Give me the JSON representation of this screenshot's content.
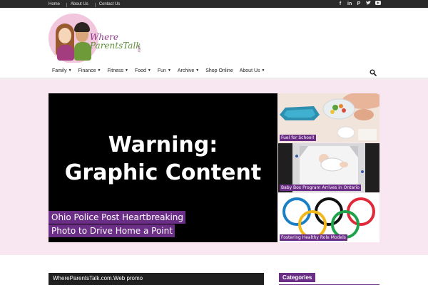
{
  "topbar": {
    "links": [
      "Home",
      "About Us",
      "Contact Us"
    ],
    "social": [
      "facebook-icon",
      "linkedin-icon",
      "pinterest-icon",
      "twitter-icon",
      "youtube-icon"
    ]
  },
  "logo": {
    "line1": "Where",
    "line2": "ParentsTalk",
    "line3": ".com"
  },
  "nav": {
    "items": [
      {
        "label": "Family",
        "dropdown": true
      },
      {
        "label": "Finance",
        "dropdown": true
      },
      {
        "label": "Fitness",
        "dropdown": true
      },
      {
        "label": "Food",
        "dropdown": true
      },
      {
        "label": "Fun",
        "dropdown": true
      },
      {
        "label": "Archive",
        "dropdown": true
      },
      {
        "label": "Shop Online",
        "dropdown": false
      },
      {
        "label": "About Us",
        "dropdown": true
      }
    ]
  },
  "featured": {
    "main": {
      "image_text_line1": "Warning:",
      "image_text_line2": "Graphic Content",
      "caption_line1": "Ohio Police Post Heartbreaking",
      "caption_line2": "Photo to Drive Home a Point"
    },
    "side": [
      {
        "label": "Fuel for School!"
      },
      {
        "label": "Baby Box Program Arrives in Ontario"
      },
      {
        "label": "Fostering Healthy Role Models"
      }
    ]
  },
  "promo": {
    "title": "WhereParentsTalk.com.Web promo"
  },
  "sidebar": {
    "categories_title": "Categories"
  },
  "colors": {
    "accent": "#6b2e86",
    "topbar": "#2b2b2b",
    "band": "#f8e7f0"
  }
}
